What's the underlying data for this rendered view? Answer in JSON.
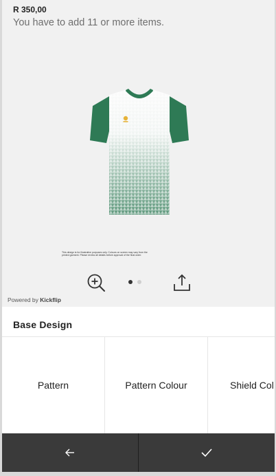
{
  "header": {
    "price": "R 350,00",
    "min_notice": "You have to add 11 or more items."
  },
  "preview": {
    "product": "green and white sublimated jersey",
    "fine_print": "This design is for illustrative purposes only. Colours on screen may vary from the printed garment. Please review all details before approval of the final order.",
    "carousel": {
      "total": 2,
      "active": 1
    },
    "icons": {
      "zoom": "zoom-in-icon",
      "share": "share-icon"
    },
    "powered_prefix": "Powered by ",
    "powered_brand": "Kickflip"
  },
  "section": {
    "title": "Base Design"
  },
  "options": [
    {
      "label": "Pattern"
    },
    {
      "label": "Pattern Colour"
    },
    {
      "label": "Shield Col"
    }
  ],
  "nav": {
    "back_icon": "arrow-left-icon",
    "confirm_icon": "check-icon"
  },
  "colors": {
    "jersey_green": "#2e7a55",
    "bar": "#3a3a3a",
    "preview_bg": "#f1f1f1"
  }
}
